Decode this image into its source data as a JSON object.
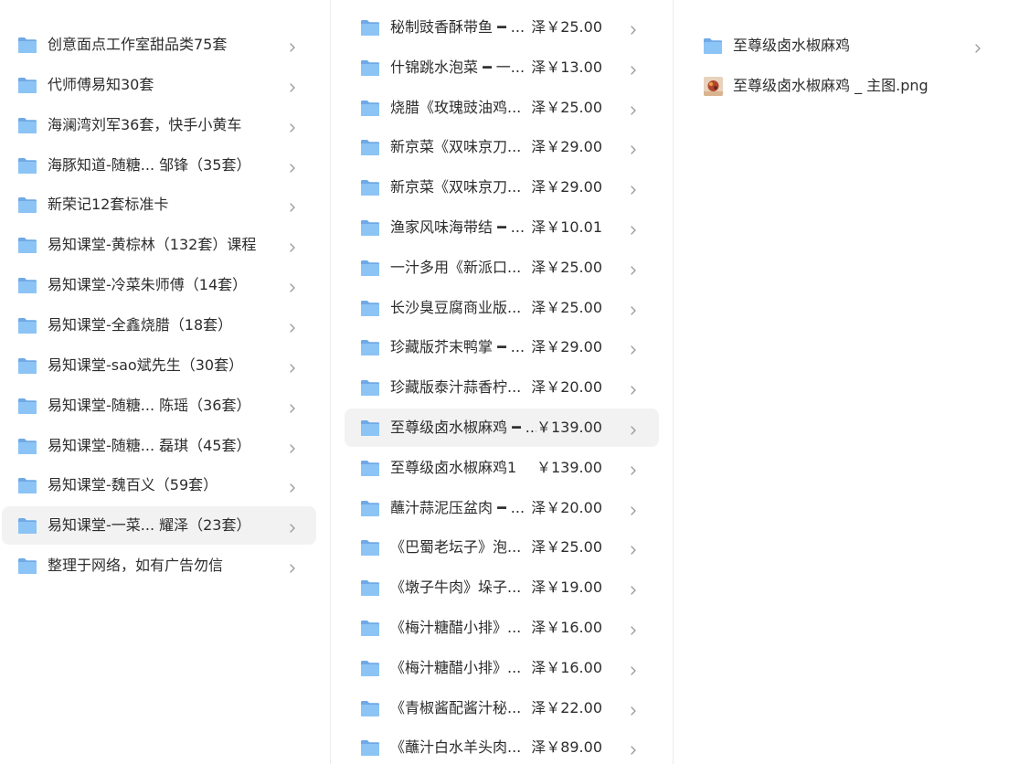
{
  "colors": {
    "folder": "#7fb8f0",
    "selected_row": "#f2f2f3",
    "chevron": "#9a9a9a",
    "divider": "#ececec"
  },
  "column1": {
    "items": [
      {
        "label": "创意面点工作室甜品类75套",
        "icon": "folder-icon"
      },
      {
        "label": "代师傅易知30套",
        "icon": "folder-icon"
      },
      {
        "label": "海澜湾刘军36套，快手小黄车",
        "icon": "folder-icon"
      },
      {
        "label": "海豚知道-随糖...   邹锋（35套）",
        "icon": "folder-icon"
      },
      {
        "label": "新荣记12套标准卡",
        "icon": "folder-icon"
      },
      {
        "label": "易知课堂-黄棕林（132套）课程",
        "icon": "folder-icon"
      },
      {
        "label": "易知课堂-冷菜朱师傅（14套）",
        "icon": "folder-icon"
      },
      {
        "label": "易知课堂-全鑫烧腊（18套）",
        "icon": "folder-icon"
      },
      {
        "label": "易知课堂-sao斌先生（30套）",
        "icon": "folder-icon"
      },
      {
        "label": "易知课堂-随糖...   陈瑶（36套）",
        "icon": "folder-icon"
      },
      {
        "label": "易知课堂-随糖...   磊琪（45套）",
        "icon": "folder-icon"
      },
      {
        "label": "易知课堂-魏百义（59套）",
        "icon": "folder-icon"
      },
      {
        "label": "易知课堂-一菜...   耀泽（23套）",
        "icon": "folder-icon",
        "selected": true
      },
      {
        "label": "整理于网络，如有广告勿信",
        "icon": "folder-icon"
      }
    ]
  },
  "column2": {
    "items": [
      {
        "label": "秘制豉香酥带鱼 ━ ...",
        "price": "泽￥25.00"
      },
      {
        "label": "什锦跳水泡菜 ━ 一...",
        "price": "泽￥13.00"
      },
      {
        "label": "烧腊《玫瑰豉油鸡...",
        "price": "泽￥25.00"
      },
      {
        "label": "新京菜《双味京刀...",
        "price": "泽￥29.00"
      },
      {
        "label": "新京菜《双味京刀...",
        "price": "泽￥29.00"
      },
      {
        "label": "渔家风味海带结 ━ ...",
        "price": "泽￥10.01"
      },
      {
        "label": "一汁多用《新派口...",
        "price": "泽￥25.00"
      },
      {
        "label": "长沙臭豆腐商业版...",
        "price": "泽￥25.00"
      },
      {
        "label": "珍藏版芥末鸭掌 ━ ...",
        "price": "泽￥29.00"
      },
      {
        "label": "珍藏版泰汁蒜香柠...",
        "price": "泽￥20.00"
      },
      {
        "label": "至尊级卤水椒麻鸡 ━ ...",
        "price": "￥139.00",
        "selected": true
      },
      {
        "label": "至尊级卤水椒麻鸡1",
        "price": "￥139.00"
      },
      {
        "label": "蘸汁蒜泥压盆肉 ━ ...",
        "price": "泽￥20.00"
      },
      {
        "label": "《巴蜀老坛子》泡...",
        "price": "泽￥25.00"
      },
      {
        "label": "《墩子牛肉》垛子...",
        "price": "泽￥19.00"
      },
      {
        "label": "《梅汁糖醋小排》...",
        "price": "泽￥16.00"
      },
      {
        "label": "《梅汁糖醋小排》...",
        "price": "泽￥16.00"
      },
      {
        "label": "《青椒酱配酱汁秘...",
        "price": "泽￥22.00"
      },
      {
        "label": "《蘸汁白水羊头肉...",
        "price": "泽￥89.00"
      }
    ]
  },
  "column3": {
    "items": [
      {
        "label": "至尊级卤水椒麻鸡",
        "type": "folder",
        "icon": "folder-icon"
      },
      {
        "label": "至尊级卤水椒麻鸡 _ 主图.png",
        "type": "file",
        "icon": "image-thumbnail-icon"
      }
    ]
  }
}
